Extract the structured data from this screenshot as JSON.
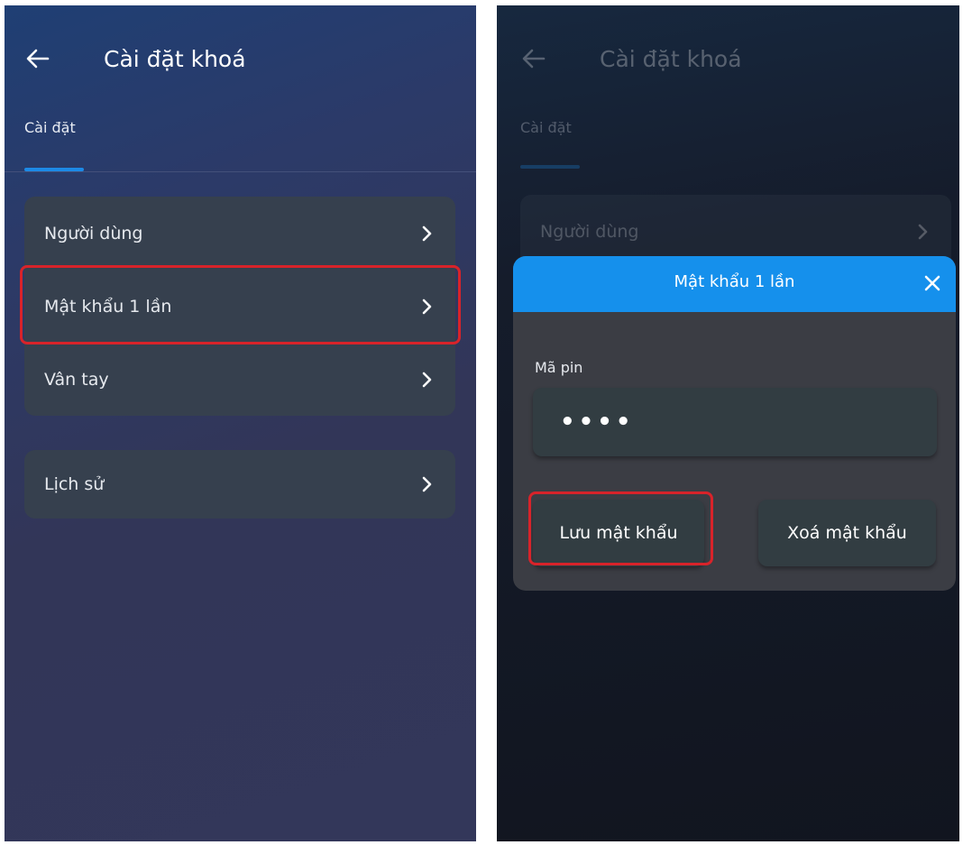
{
  "left": {
    "header": {
      "title": "Cài đặt khoá"
    },
    "tab": {
      "label": "Cài đặt"
    },
    "groups": [
      {
        "items": [
          {
            "label": "Người dùng"
          },
          {
            "label": "Mật khẩu 1 lần"
          },
          {
            "label": "Vân tay"
          }
        ]
      },
      {
        "items": [
          {
            "label": "Lịch sử"
          }
        ]
      }
    ]
  },
  "right": {
    "header": {
      "title": "Cài đặt khoá"
    },
    "tab": {
      "label": "Cài đặt"
    },
    "list": {
      "first_item": "Người dùng"
    },
    "dialog": {
      "title": "Mật khẩu 1 lần",
      "pin_label": "Mã pin",
      "pin_value": "••••",
      "save_label": "Lưu mật khẩu",
      "delete_label": "Xoá mật khẩu"
    }
  },
  "colors": {
    "accent": "#1590ec",
    "highlight": "#d8232a",
    "card": "#36404e"
  },
  "icons": [
    "arrow-left-icon",
    "chevron-right-icon",
    "close-icon"
  ]
}
